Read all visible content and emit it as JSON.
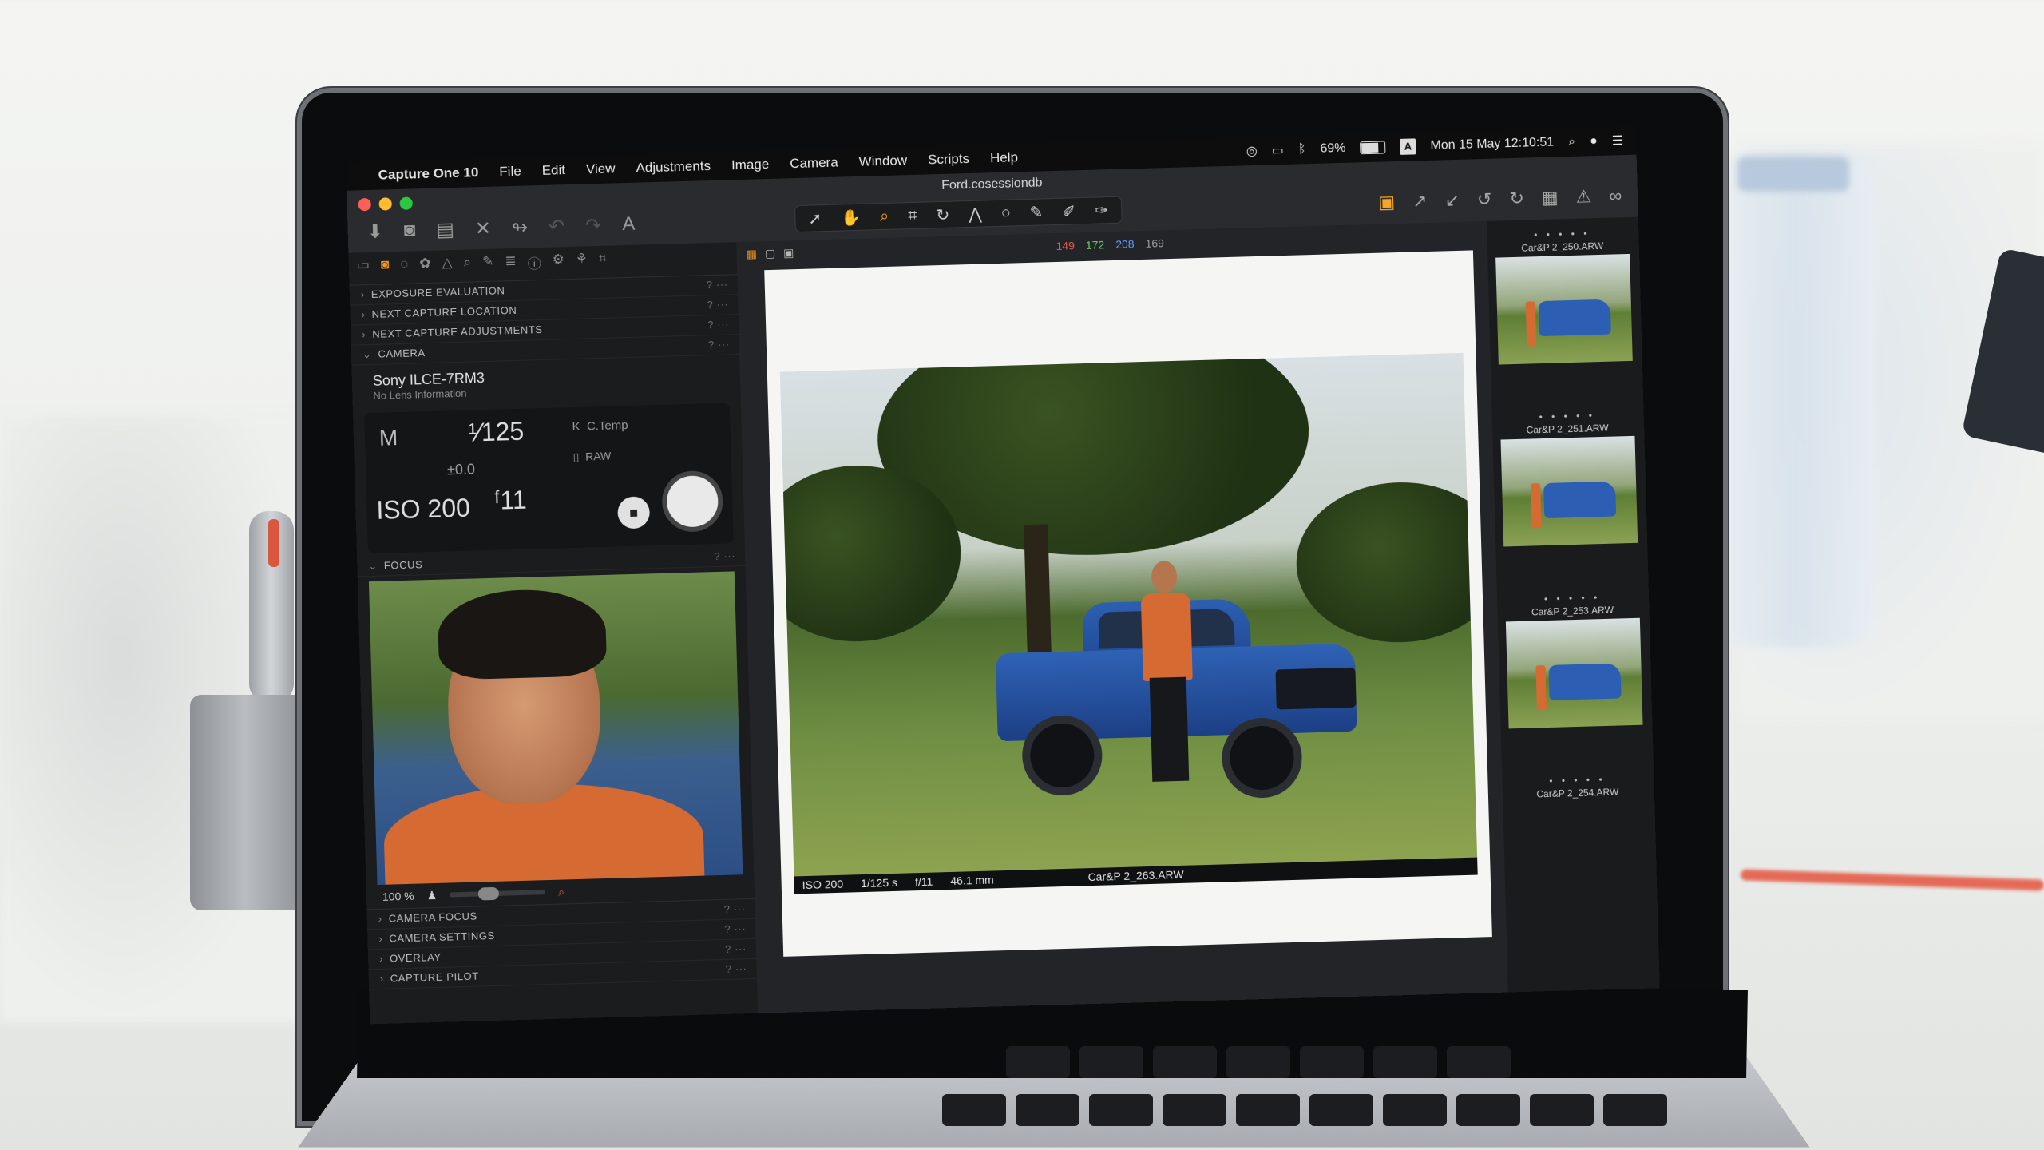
{
  "menubar": {
    "app": "Capture One 10",
    "menus": [
      "File",
      "Edit",
      "View",
      "Adjustments",
      "Image",
      "Camera",
      "Window",
      "Scripts",
      "Help"
    ],
    "battery": "69%",
    "input_source": "A",
    "datetime": "Mon 15 May  12:10:51"
  },
  "window": {
    "title": "Ford.cosessiondb"
  },
  "left_panel": {
    "sections_top": [
      "EXPOSURE EVALUATION",
      "NEXT CAPTURE LOCATION",
      "NEXT CAPTURE ADJUSTMENTS"
    ],
    "camera_section": "CAMERA",
    "camera_name": "Sony ILCE-7RM3",
    "lens_info": "No Lens Information",
    "mode": "M",
    "shutter": "¹⁄125",
    "exposure_comp": "±0.0",
    "iso": "ISO 200",
    "aperture": "ᶠ11",
    "white_balance": "C.Temp",
    "format": "RAW",
    "focus_section": "FOCUS",
    "focus_zoom": "100 %",
    "sections_bottom": [
      "CAMERA FOCUS",
      "CAMERA SETTINGS",
      "OVERLAY",
      "CAPTURE PILOT"
    ]
  },
  "viewer": {
    "rgb": {
      "r": "149",
      "g": "172",
      "b": "208",
      "l": "169"
    },
    "caption_iso": "ISO 200",
    "caption_shutter": "1/125 s",
    "caption_aperture": "f/11",
    "caption_focal": "46.1 mm",
    "caption_file": "Car&P 2_263.ARW"
  },
  "browser": {
    "thumbnails": [
      {
        "name": "Car&P 2_250.ARW",
        "stars": "• • • • •"
      },
      {
        "name": "Car&P 2_251.ARW",
        "stars": "• • • • •"
      },
      {
        "name": "Car&P 2_253.ARW",
        "stars": "• • • • •"
      },
      {
        "name": "Car&P 2_254.ARW",
        "stars": "• • • • •"
      }
    ]
  },
  "colors": {
    "accent": "#f39a1a",
    "red": "#e9574a",
    "green": "#6bd16a",
    "blue": "#5f9bff"
  }
}
